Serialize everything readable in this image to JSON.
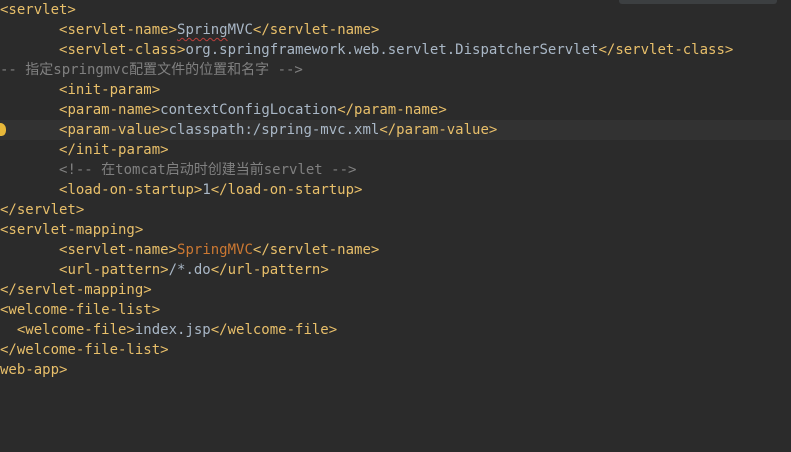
{
  "editor": {
    "lines": [
      {
        "indent": 0,
        "tokens": [
          {
            "c": "tag",
            "t": "<servlet>"
          }
        ]
      },
      {
        "indent": 7,
        "tokens": [
          {
            "c": "tag",
            "t": "<servlet-name>"
          },
          {
            "c": "text",
            "t": "Spring",
            "sq": true
          },
          {
            "c": "text",
            "t": "MVC"
          },
          {
            "c": "tag",
            "t": "</servlet-name>"
          }
        ]
      },
      {
        "indent": 7,
        "tokens": [
          {
            "c": "tag",
            "t": "<servlet-class>"
          },
          {
            "c": "text",
            "t": "org.springframework.web.servlet.DispatcherServlet"
          },
          {
            "c": "tag",
            "t": "</servlet-class>"
          }
        ]
      },
      {
        "indent": 0,
        "tokens": [
          {
            "c": "comment",
            "t": "-- 指定springmvc配置文件的位置和名字 -->"
          }
        ]
      },
      {
        "indent": 7,
        "tokens": [
          {
            "c": "tag",
            "t": "<init-param>"
          }
        ]
      },
      {
        "indent": 7,
        "tokens": [
          {
            "c": "tag",
            "t": "<param-name>"
          },
          {
            "c": "text",
            "t": "contextConfigLocation"
          },
          {
            "c": "tag",
            "t": "</param-name>"
          }
        ]
      },
      {
        "indent": 7,
        "current": true,
        "bulb": true,
        "tokens": [
          {
            "c": "tag",
            "t": "<param-value>"
          },
          {
            "c": "text",
            "t": "classpath:/spring-mvc.xml"
          },
          {
            "c": "tag",
            "t": "</param-value>"
          }
        ]
      },
      {
        "indent": 7,
        "tokens": [
          {
            "c": "tag",
            "t": "</init-param>"
          }
        ]
      },
      {
        "indent": 7,
        "tokens": [
          {
            "c": "comment",
            "t": "<!-- 在tomcat启动时创建当前servlet -->"
          }
        ]
      },
      {
        "indent": 7,
        "tokens": [
          {
            "c": "tag",
            "t": "<load-on-startup>"
          },
          {
            "c": "text",
            "t": "1"
          },
          {
            "c": "tag",
            "t": "</load-on-startup>"
          }
        ]
      },
      {
        "indent": 0,
        "tokens": [
          {
            "c": "tag",
            "t": "</servlet>"
          }
        ]
      },
      {
        "indent": 0,
        "tokens": [
          {
            "c": "tag",
            "t": "<servlet-mapping>"
          }
        ]
      },
      {
        "indent": 7,
        "tokens": [
          {
            "c": "tag",
            "t": "<servlet-name>"
          },
          {
            "c": "err",
            "t": "SpringMVC"
          },
          {
            "c": "tag",
            "t": "</servlet-name>"
          }
        ]
      },
      {
        "indent": 7,
        "tokens": [
          {
            "c": "tag",
            "t": "<url-pattern>"
          },
          {
            "c": "text",
            "t": "/*.do"
          },
          {
            "c": "tag",
            "t": "</url-pattern>"
          }
        ]
      },
      {
        "indent": 0,
        "tokens": [
          {
            "c": "tag",
            "t": "</servlet-mapping>"
          }
        ]
      },
      {
        "indent": 0,
        "tokens": [
          {
            "c": "tag",
            "t": "<welcome-file-list>"
          }
        ]
      },
      {
        "indent": 2,
        "tokens": [
          {
            "c": "tag",
            "t": "<welcome-file>"
          },
          {
            "c": "text",
            "t": "index.jsp"
          },
          {
            "c": "tag",
            "t": "</welcome-file>"
          }
        ]
      },
      {
        "indent": 0,
        "tokens": [
          {
            "c": "tag",
            "t": "</welcome-file-list>"
          }
        ]
      },
      {
        "indent": 0,
        "tokens": [
          {
            "c": "tag",
            "t": "web-app>"
          }
        ]
      }
    ]
  },
  "colors": {
    "background": "#2b2b2b",
    "tag": "#e8bf6a",
    "text": "#a9b7c6",
    "comment": "#808080",
    "error_text": "#cc7832",
    "current_line": "#323232",
    "intention_bulb": "#e8b83a"
  },
  "icons": {
    "gutter": "lightbulb-icon"
  }
}
